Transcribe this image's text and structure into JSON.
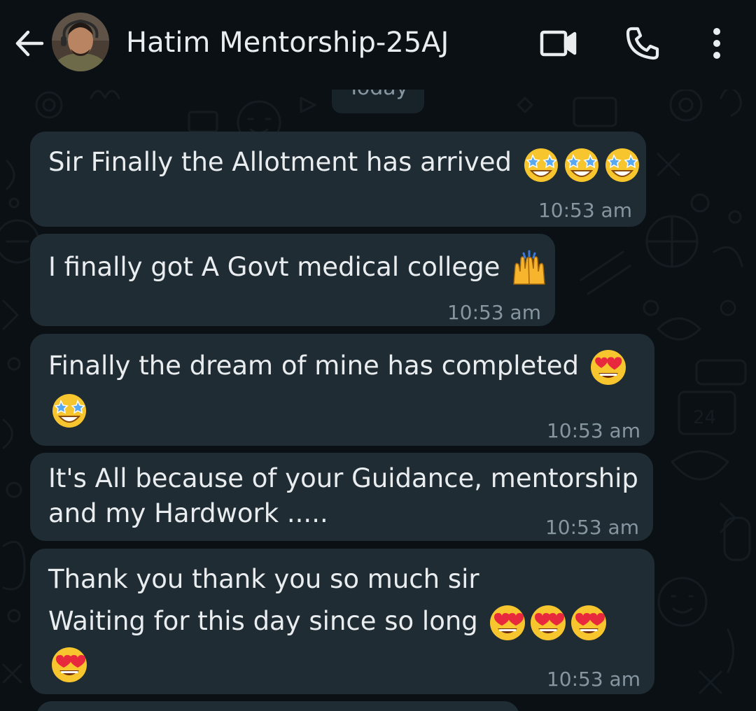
{
  "header": {
    "contact_name": "Hatim Mentorship-25AJ",
    "back_icon": "arrow-left-icon",
    "video_icon": "video-camera-icon",
    "call_icon": "phone-icon",
    "menu_icon": "more-vertical-icon"
  },
  "chat": {
    "date_chip": "Today",
    "messages": [
      {
        "text": "Sir Finally the Allotment has arrived",
        "emojis": [
          "star-struck",
          "star-struck",
          "star-struck"
        ],
        "time": "10:53 am"
      },
      {
        "text": "I finally got A Govt medical college",
        "emojis": [
          "raising-hands"
        ],
        "time": "10:53 am"
      },
      {
        "text": "Finally the dream of mine has completed",
        "emojis": [
          "heart-eyes",
          "star-struck"
        ],
        "time": "10:53 am"
      },
      {
        "text_line1": "It's All because of your Guidance,  mentorship",
        "text_line2": "and my Hardwork .....",
        "time": "10:53 am"
      },
      {
        "text_line1": "Thank you thank you so much sir",
        "text_line2": "Waiting for this day since so long",
        "emojis": [
          "heart-eyes",
          "heart-eyes",
          "heart-eyes",
          "heart-eyes"
        ],
        "time": "10:53 am"
      }
    ]
  },
  "colors": {
    "background": "#0b1014",
    "bubble": "#202c33",
    "text": "#e9edef",
    "meta_text": "#8696a0"
  }
}
